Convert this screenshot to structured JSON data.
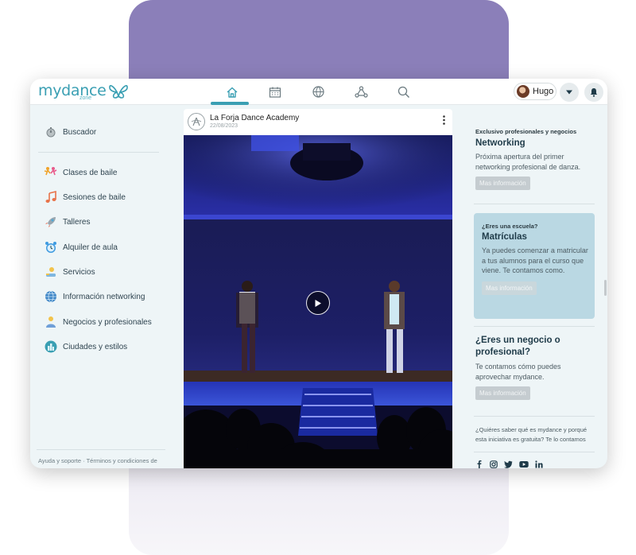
{
  "app": {
    "logo_text": "mydance",
    "logo_sub": "zone"
  },
  "nav": {
    "items": [
      "home-icon",
      "calendar-icon",
      "globe-icon",
      "network-icon",
      "search-icon"
    ],
    "active": "home-icon"
  },
  "user": {
    "name": "Hugo"
  },
  "colors": {
    "accent": "#3a9fb3",
    "purple": "#8b7fb9",
    "panel": "#eef5f7",
    "promo": "#bad8e3"
  },
  "sidebar": {
    "search_label": "Buscador",
    "items": [
      {
        "label": "Clases de baile",
        "icon": "dancers-icon"
      },
      {
        "label": "Sesiones de baile",
        "icon": "music-note-icon"
      },
      {
        "label": "Talleres",
        "icon": "rocket-icon"
      },
      {
        "label": "Alquiler de aula",
        "icon": "clock-icon"
      },
      {
        "label": "Servicios",
        "icon": "services-icon"
      },
      {
        "label": "Información networking",
        "icon": "world-icon"
      },
      {
        "label": "Negocios y profesionales",
        "icon": "people-icon"
      },
      {
        "label": "Ciudades y estilos",
        "icon": "city-icon"
      }
    ],
    "footer": "Ayuda y soporte · Términos y condiciones de"
  },
  "post": {
    "author": "La Forja Dance Academy",
    "date": "22/08/2023"
  },
  "right": {
    "networking": {
      "kicker": "Exclusivo profesionales y negocios",
      "title": "Networking",
      "body": "Próxima apertura del primer networking profesional de danza.",
      "button": "Mas información"
    },
    "matriculas": {
      "kicker": "¿Eres una escuela?",
      "title": "Matrículas",
      "body": "Ya puedes comenzar a matricular a tus alumnos para el curso que viene. Te contamos como.",
      "button": "Mas información"
    },
    "negocio": {
      "title": "¿Eres un negocio o profesional?",
      "body": "Te contamos cómo puedes aprovechar mydance.",
      "button": "Mas información"
    },
    "about": "¿Quiéres saber qué es mydance y porqué esta iniciativa es gratuita? Te lo contamos",
    "social": [
      "facebook-icon",
      "instagram-icon",
      "twitter-icon",
      "youtube-icon",
      "linkedin-icon"
    ]
  }
}
